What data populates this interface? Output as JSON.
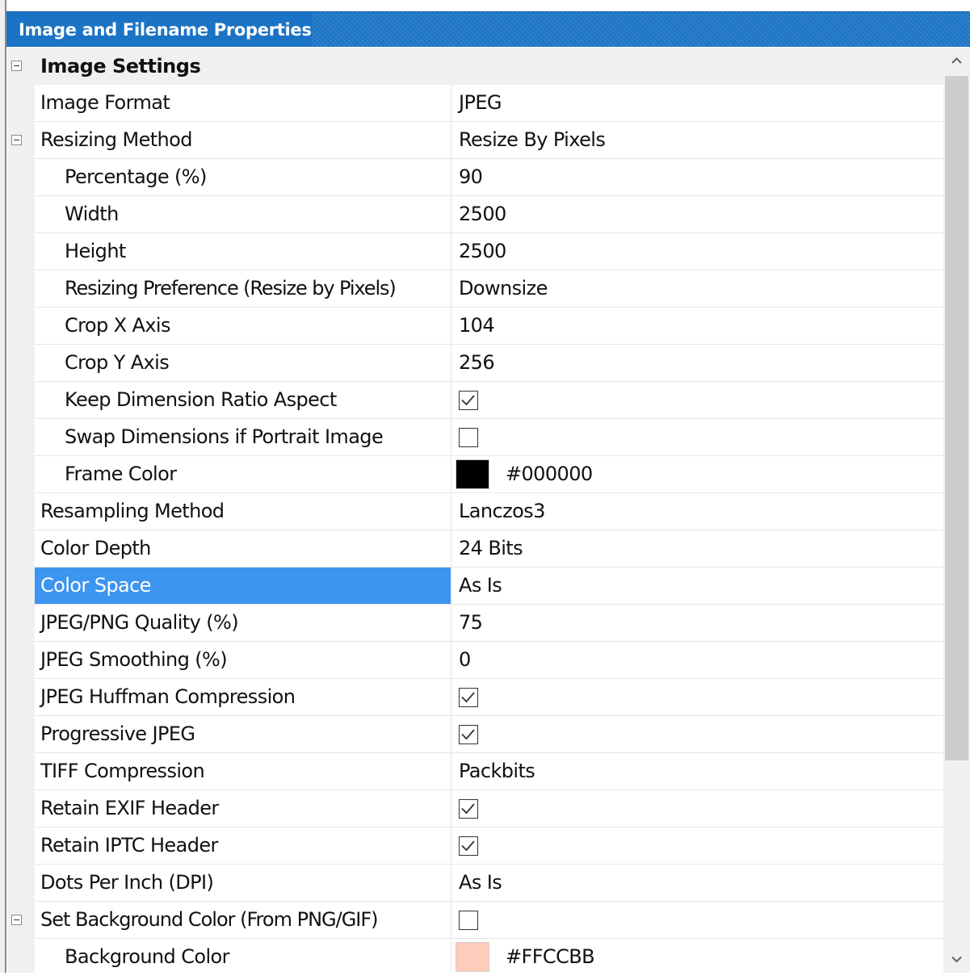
{
  "window": {
    "title": "Image and Filename Properties"
  },
  "category": {
    "label": "Image Settings"
  },
  "rows": [
    {
      "label": "Image Format",
      "value": "JPEG"
    },
    {
      "label": "Resizing Method",
      "value": "Resize By Pixels"
    },
    {
      "label": "Percentage (%)",
      "value": "90"
    },
    {
      "label": "Width",
      "value": "2500"
    },
    {
      "label": "Height",
      "value": "2500"
    },
    {
      "label": "Resizing Preference (Resize by Pixels)",
      "value": "Downsize"
    },
    {
      "label": "Crop X Axis",
      "value": "104"
    },
    {
      "label": "Crop Y Axis",
      "value": "256"
    },
    {
      "label": "Keep Dimension Ratio Aspect",
      "checked": true
    },
    {
      "label": "Swap Dimensions if Portrait Image",
      "checked": false
    },
    {
      "label": "Frame Color",
      "color": "#000000",
      "value": "#000000"
    },
    {
      "label": "Resampling Method",
      "value": "Lanczos3"
    },
    {
      "label": "Color Depth",
      "value": "24 Bits"
    },
    {
      "label": "Color Space",
      "value": "As Is",
      "selected": true
    },
    {
      "label": "JPEG/PNG Quality (%)",
      "value": "75"
    },
    {
      "label": "JPEG Smoothing (%)",
      "value": "0"
    },
    {
      "label": "JPEG Huffman Compression",
      "checked": true
    },
    {
      "label": "Progressive JPEG",
      "checked": true
    },
    {
      "label": "TIFF Compression",
      "value": "Packbits"
    },
    {
      "label": "Retain EXIF Header",
      "checked": true
    },
    {
      "label": "Retain IPTC Header",
      "checked": true
    },
    {
      "label": "Dots Per Inch (DPI)",
      "value": "As Is"
    },
    {
      "label": "Set Background Color (From PNG/GIF)",
      "checked": false
    },
    {
      "label": "Background Color",
      "color": "#FFCCBB",
      "value": "#FFCCBB"
    }
  ],
  "colors": {
    "titlebar": "#1a73c4",
    "selection": "#3c95f0",
    "gutter": "#f0f0f0",
    "gridline": "#e6e6e6"
  }
}
